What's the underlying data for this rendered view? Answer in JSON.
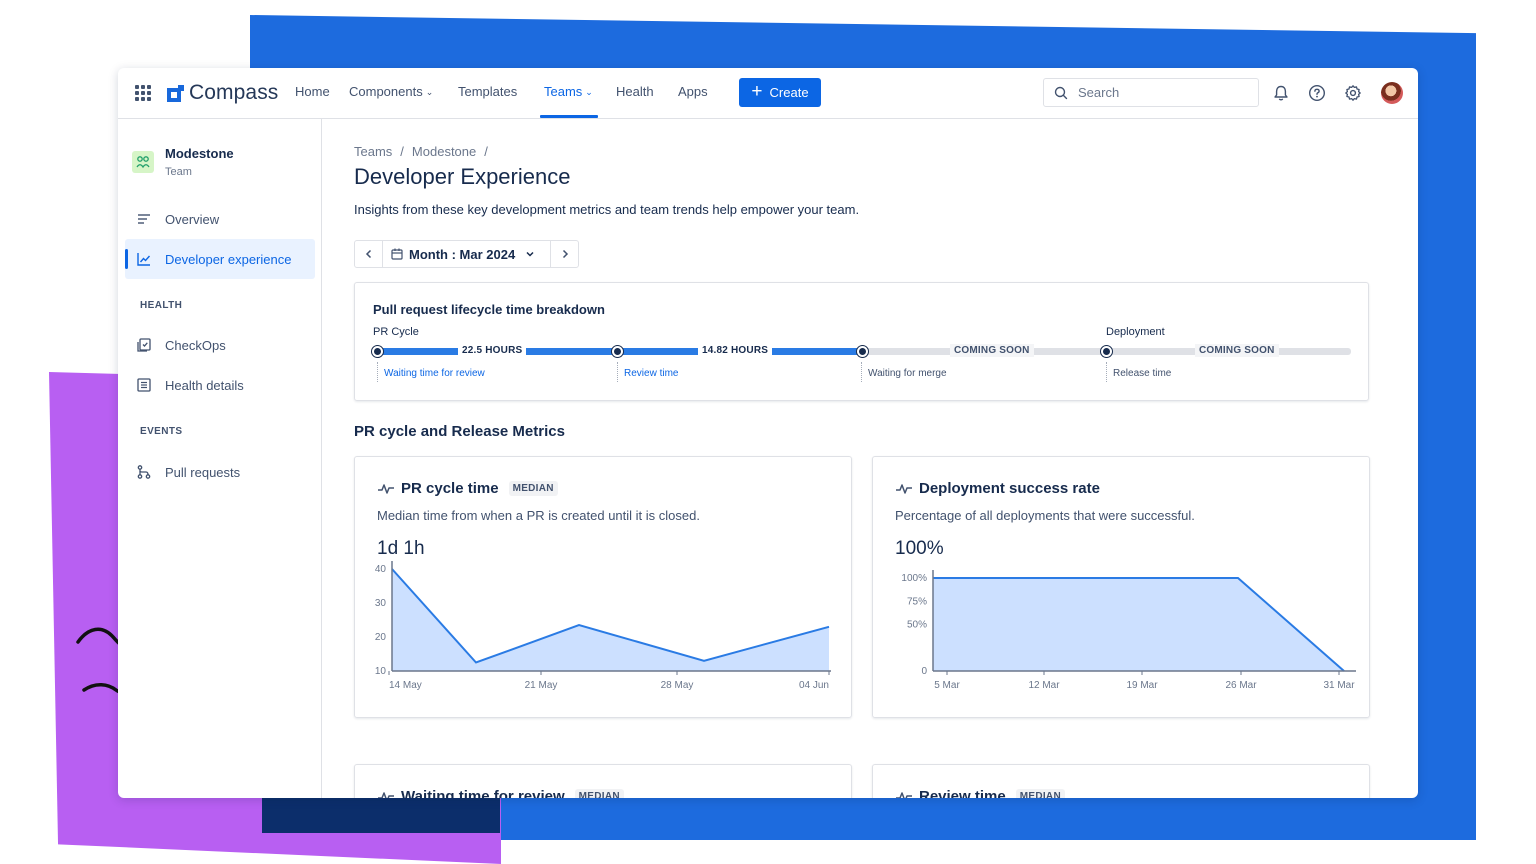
{
  "nav": {
    "logo": "Compass",
    "items": [
      {
        "label": "Home",
        "caret": false,
        "active": false
      },
      {
        "label": "Components",
        "caret": true,
        "active": false
      },
      {
        "label": "Templates",
        "caret": false,
        "active": false
      },
      {
        "label": "Teams",
        "caret": true,
        "active": true
      },
      {
        "label": "Health",
        "caret": false,
        "active": false
      },
      {
        "label": "Apps",
        "caret": false,
        "active": false
      }
    ],
    "create_label": "Create",
    "search_placeholder": "Search",
    "icons": [
      "bell-icon",
      "help-icon",
      "settings-icon"
    ]
  },
  "sidebar": {
    "team_name": "Modestone",
    "team_sub": "Team",
    "items": [
      {
        "label": "Overview",
        "icon": "overview-icon",
        "active": false
      },
      {
        "label": "Developer experience",
        "icon": "line-chart-icon",
        "active": true
      }
    ],
    "health_heading": "HEALTH",
    "health_items": [
      {
        "label": "CheckOps",
        "icon": "checkops-icon"
      },
      {
        "label": "Health details",
        "icon": "health-details-icon"
      }
    ],
    "events_heading": "EVENTS",
    "events_items": [
      {
        "label": "Pull requests",
        "icon": "pull-request-icon"
      }
    ]
  },
  "main": {
    "breadcrumb": [
      "Teams",
      "Modestone"
    ],
    "title": "Developer Experience",
    "description": "Insights from these key development metrics and team trends help empower your team.",
    "date_picker_label": "Month : Mar 2024",
    "lifecycle": {
      "title": "Pull request lifecycle time breakdown",
      "pr_cycle_label": "PR Cycle",
      "deployment_label": "Deployment",
      "segments": [
        {
          "badge": "22.5 HOURS",
          "stage": "Waiting time for review",
          "status": "active"
        },
        {
          "badge": "14.82 HOURS",
          "stage": "Review time",
          "status": "active"
        },
        {
          "badge": "COMING SOON",
          "stage": "Waiting for merge",
          "status": "coming"
        },
        {
          "badge": "COMING SOON",
          "stage": "Release time",
          "status": "coming"
        }
      ]
    },
    "metrics_title": "PR cycle and Release Metrics",
    "cards": [
      {
        "title": "PR cycle time",
        "badge": "MEDIAN",
        "description": "Median time from when a PR is created until it is closed.",
        "value": "1d 1h"
      },
      {
        "title": "Deployment success rate",
        "badge": "",
        "description": "Percentage of all deployments that were successful.",
        "value": "100%"
      }
    ],
    "partial_cards": [
      {
        "title": "Waiting time for review",
        "badge": "MEDIAN"
      },
      {
        "title": "Review time",
        "badge": "MEDIAN"
      }
    ]
  },
  "colors": {
    "accent": "#0C66E4",
    "chart_fill": "#CCE0FF",
    "chart_line": "#2A7BE4",
    "bg_blue": "#1D6BDE",
    "bg_purple": "#B85FF2"
  },
  "chart_data": [
    {
      "type": "area",
      "x": [
        "14 May",
        "~19 May",
        "~25 May",
        "~31 May",
        "04 Jun"
      ],
      "x_ticks": [
        "14 May",
        "21 May",
        "28 May",
        "04 Jun"
      ],
      "values": [
        40,
        12.5,
        23.5,
        13,
        23
      ],
      "y_ticks": [
        10,
        20,
        30,
        40
      ],
      "ylim": [
        10,
        40
      ],
      "grid": false
    },
    {
      "type": "area",
      "x": [
        "5 Mar",
        "28 Mar",
        "31 Mar"
      ],
      "x_ticks": [
        "5 Mar",
        "12 Mar",
        "19 Mar",
        "26 Mar",
        "31 Mar"
      ],
      "values": [
        100,
        100,
        0
      ],
      "y_ticks": [
        "0",
        "50%",
        "75%",
        "100%"
      ],
      "ylim": [
        0,
        100
      ],
      "grid": false
    }
  ]
}
